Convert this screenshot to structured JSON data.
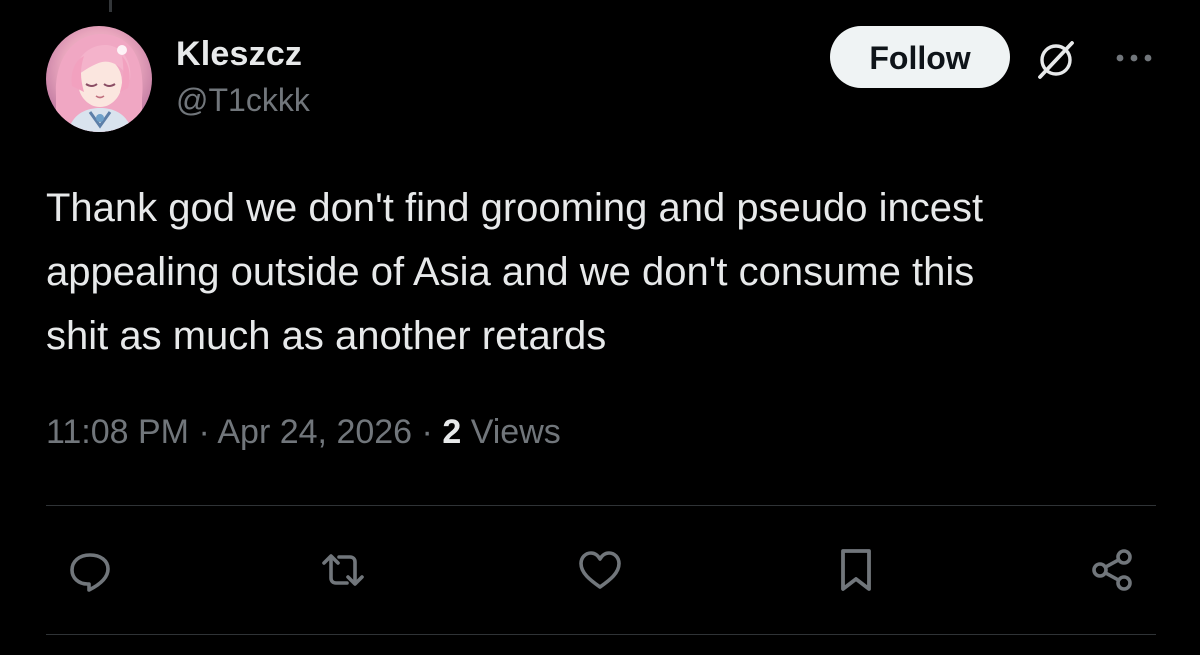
{
  "author": {
    "display_name": "Kleszcz",
    "handle": "@T1ckkk"
  },
  "header": {
    "follow_label": "Follow",
    "icons": [
      "grok-icon",
      "more-icon"
    ]
  },
  "tweet": {
    "text": "Thank god we don't find grooming and pseudo incest\nappealing outside of Asia and we don't consume this\nshit as much as another retards",
    "time": "11:08 PM",
    "date": "Apr 24, 2026",
    "views_count": "2",
    "views_label": "Views",
    "separator": "·"
  },
  "actions": {
    "icons": [
      "reply-icon",
      "retweet-icon",
      "like-icon",
      "bookmark-icon",
      "share-icon"
    ]
  },
  "colors": {
    "background": "#000000",
    "text_primary": "#e7e9ea",
    "text_secondary": "#71767b",
    "divider": "#2f3336",
    "follow_bg": "#eff3f4",
    "follow_text": "#0f1419"
  }
}
